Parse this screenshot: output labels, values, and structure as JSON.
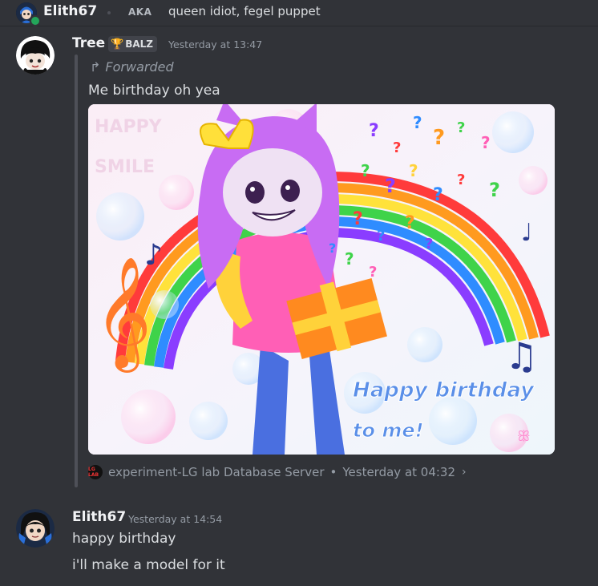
{
  "header": {
    "username": "Elith67",
    "aka_label": "AKA",
    "aka_names": "queen idiot, fegel puppet"
  },
  "messages": [
    {
      "author": "Tree",
      "role_tag": "BALZ",
      "timestamp": "Yesterday at 13:47",
      "forwarded_label": "Forwarded",
      "text": "Me birthday oh yea",
      "image": {
        "title_lines": [
          "Happy birthday",
          "to me!"
        ],
        "faded_text": [
          "HAPPY",
          "SMILE"
        ]
      },
      "source": {
        "server_icon_text": "LG LAB",
        "server": "experiment-LG lab Database Server",
        "timestamp": "Yesterday at 04:32"
      }
    },
    {
      "author": "Elith67",
      "timestamp": "Yesterday at 14:54",
      "lines": [
        "happy birthday",
        "i'll make a model for it"
      ]
    }
  ],
  "colors": {
    "background": "#313338",
    "username": "#f2f3f5",
    "muted": "#949ba4",
    "online": "#23a55a",
    "trophy": "#f0b232"
  }
}
